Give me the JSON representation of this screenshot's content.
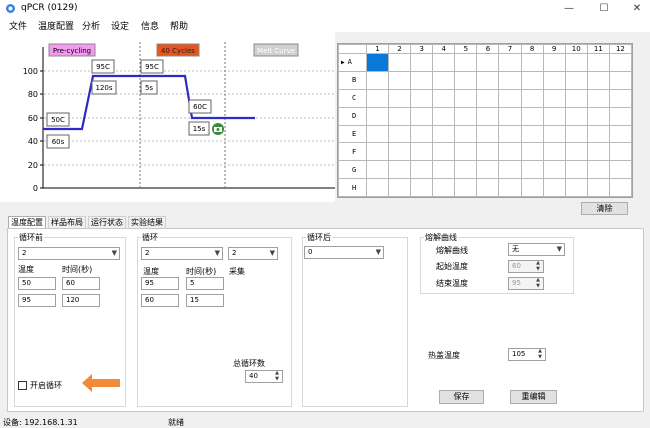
{
  "window": {
    "title": "qPCR (0129)",
    "minimize": "—",
    "maximize": "☐",
    "close": "✕"
  },
  "menu": [
    "文件",
    "温度配置",
    "分析",
    "设定",
    "信息",
    "帮助"
  ],
  "chart": {
    "badges": {
      "pre_cycling": "Pre-cycling",
      "cycles": "40 Cycles",
      "melt_curve": "Melt Curve"
    },
    "y_ticks": [
      "100",
      "80",
      "60",
      "40",
      "20",
      "0"
    ],
    "steps": [
      {
        "temp": "50C",
        "time": "60s"
      },
      {
        "temp": "95C",
        "time": "120s"
      },
      {
        "temp": "95C",
        "time": "5s"
      },
      {
        "temp": "60C",
        "time": "15s"
      }
    ],
    "colors": {
      "profile": "#2b2bc8",
      "pre_badge": "#f49bf0",
      "cycle_badge": "#e8541d",
      "camera": "#3d8a3d"
    }
  },
  "plate": {
    "columns": [
      "1",
      "2",
      "3",
      "4",
      "5",
      "6",
      "7",
      "8",
      "9",
      "10",
      "11",
      "12"
    ],
    "rows": [
      "A",
      "B",
      "C",
      "D",
      "E",
      "F",
      "G",
      "H"
    ],
    "current_row_marker": "▶",
    "selected": "A1",
    "clear_button": "清除"
  },
  "tabs": [
    "温度配置",
    "样品布局",
    "运行状态",
    "实验结果"
  ],
  "pre_cycle": {
    "title": "循环前",
    "step_count": "2",
    "temp_label": "温度",
    "time_label": "时间(秒)",
    "rows": [
      {
        "temp": "50",
        "time": "60"
      },
      {
        "temp": "95",
        "time": "120"
      }
    ],
    "enable_loop_label": "开启循环"
  },
  "cycle": {
    "title": "循环",
    "step_count": "2",
    "collect_step": "2",
    "temp_label": "温度",
    "time_label": "时间(秒)",
    "collect_label": "采集",
    "rows": [
      {
        "temp": "95",
        "time": "5"
      },
      {
        "temp": "60",
        "time": "15"
      }
    ],
    "total_label": "总循环数",
    "total_value": "40"
  },
  "post_cycle": {
    "title": "循环后",
    "step_count": "0"
  },
  "melt": {
    "title": "熔解曲线",
    "curve_label": "熔解曲线",
    "curve_value": "无",
    "start_label": "起始温度",
    "start_value": "60",
    "end_label": "结束温度",
    "end_value": "95"
  },
  "lid": {
    "label": "热盖温度",
    "value": "105"
  },
  "actions": {
    "save": "保存",
    "reedit": "重编辑"
  },
  "status": {
    "device": "设备: 192.168.1.31",
    "state": "就绪"
  }
}
